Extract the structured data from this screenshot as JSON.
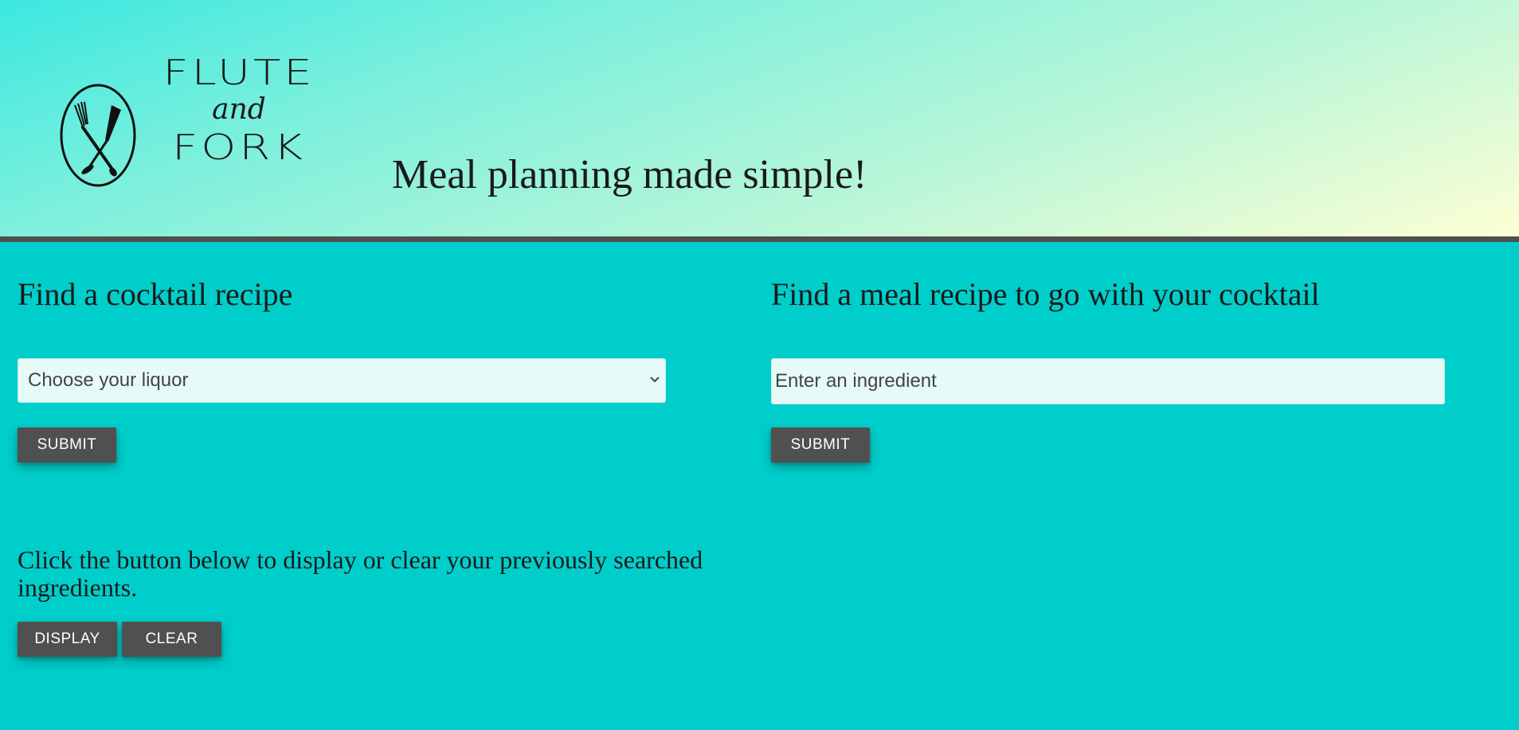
{
  "header": {
    "brand_line1": "Flute",
    "brand_line2": "and",
    "brand_line3": "Fork",
    "tagline": "Meal planning made simple!",
    "logo_icon": "fork-and-flute-glass-icon"
  },
  "cocktail": {
    "heading": "Find a cocktail recipe",
    "select_value": "Choose your liquor",
    "submit_label": "SUBMIT",
    "history_prompt": "Click the button below to display or clear your previously searched ingredients.",
    "display_label": "DISPLAY",
    "clear_label": "CLEAR"
  },
  "meal": {
    "heading": "Find a meal recipe to go with your cocktail",
    "input_placeholder": "Enter an ingredient",
    "submit_label": "SUBMIT"
  },
  "colors": {
    "page_background": "#00cecb",
    "button_background": "#505050",
    "header_border": "#4f4f4f",
    "input_background": "#e6fbf8"
  }
}
